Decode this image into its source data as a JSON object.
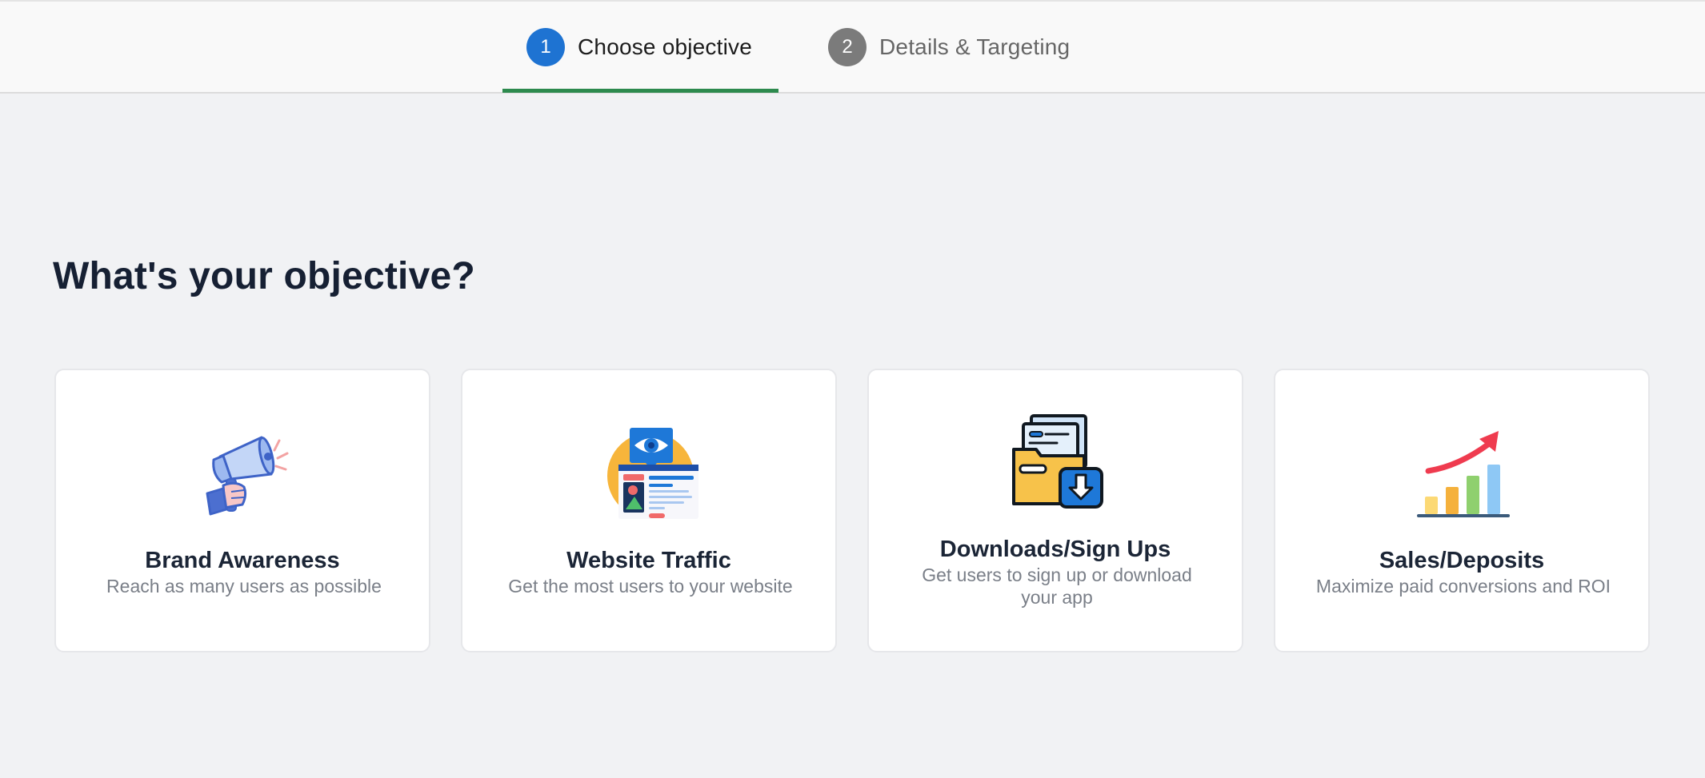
{
  "stepper": {
    "steps": [
      {
        "number": "1",
        "label": "Choose objective",
        "state": "active"
      },
      {
        "number": "2",
        "label": "Details & Targeting",
        "state": "inactive"
      }
    ],
    "active_color": "#1e73d2",
    "inactive_color": "#7b7b7b",
    "indicator_color": "#2d8a4e"
  },
  "main": {
    "heading": "What's your objective?",
    "cards": [
      {
        "icon": "megaphone-icon",
        "title": "Brand Awareness",
        "description": "Reach as many users as possible"
      },
      {
        "icon": "website-eye-icon",
        "title": "Website Traffic",
        "description": "Get the most users to your website"
      },
      {
        "icon": "download-folder-icon",
        "title": "Downloads/Sign Ups",
        "description": "Get users to sign up or download your app"
      },
      {
        "icon": "growth-chart-icon",
        "title": "Sales/Deposits",
        "description": "Maximize paid conversions and ROI"
      }
    ]
  }
}
